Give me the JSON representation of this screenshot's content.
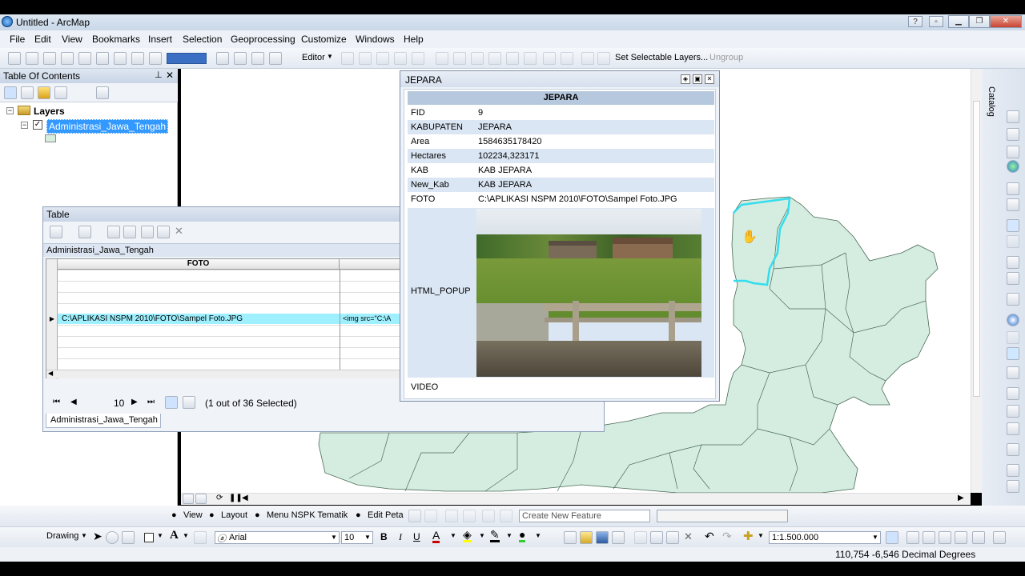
{
  "window": {
    "title": "Untitled - ArcMap"
  },
  "menu": [
    "File",
    "Edit",
    "View",
    "Bookmarks",
    "Insert",
    "Selection",
    "Geoprocessing",
    "Customize",
    "Windows",
    "Help"
  ],
  "toolbar": {
    "editor": "Editor",
    "set_selectable": "Set Selectable Layers...",
    "ungroup": "Ungroup"
  },
  "toc": {
    "title": "Table Of Contents",
    "layers": "Layers",
    "layer_name": "Administrasi_Jawa_Tengah"
  },
  "table": {
    "title": "Table",
    "subtitle": "Administrasi_Jawa_Tengah",
    "column": "FOTO",
    "selected_value": "C:\\APLIKASI NSPM 2010\\FOTO\\Sampel Foto.JPG",
    "html_value": "<img src=\"C:\\A",
    "record": "10",
    "selected_info": "(1 out of 36 Selected)",
    "tab": "Administrasi_Jawa_Tengah"
  },
  "popup": {
    "title": "JEPARA",
    "header": "JEPARA",
    "rows": [
      {
        "k": "FID",
        "v": "9"
      },
      {
        "k": "KABUPATEN",
        "v": "JEPARA"
      },
      {
        "k": "Area",
        "v": "1584635178420"
      },
      {
        "k": "Hectares",
        "v": "102234,323171"
      },
      {
        "k": "KAB",
        "v": "KAB JEPARA"
      },
      {
        "k": "New_Kab",
        "v": "KAB JEPARA"
      },
      {
        "k": "FOTO",
        "v": "C:\\APLIKASI NSPM 2010\\FOTO\\Sampel Foto.JPG"
      }
    ],
    "html_popup": "HTML_POPUP",
    "video": "VIDEO"
  },
  "right": {
    "catalog": "Catalog"
  },
  "bottom1": {
    "view": "View",
    "layout": "Layout",
    "menu_nspk": "Menu NSPK Tematik",
    "edit_peta": "Edit Peta",
    "create_feature": "Create New Feature"
  },
  "bottom2": {
    "drawing": "Drawing",
    "font": "Arial",
    "size": "10",
    "bold": "B",
    "italic": "I",
    "underline": "U",
    "text_a": "A",
    "scale": "1:1.500.000"
  },
  "status": {
    "coords": "110,754  -6,546 Decimal Degrees"
  }
}
